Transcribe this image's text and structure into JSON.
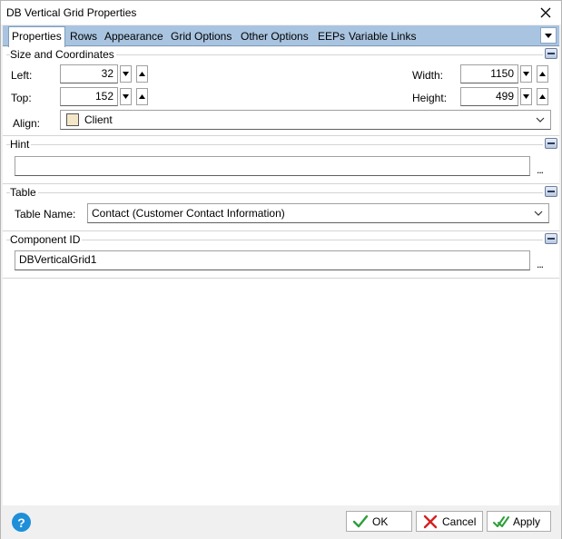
{
  "window": {
    "title": "DB Vertical Grid Properties"
  },
  "tabs": [
    {
      "label": "Properties",
      "active": true
    },
    {
      "label": "Rows"
    },
    {
      "label": "Appearance"
    },
    {
      "label": "Grid Options"
    },
    {
      "label": "Other Options"
    },
    {
      "label": "EEPs"
    },
    {
      "label": "Variable Links"
    }
  ],
  "size_section": {
    "title": "Size and Coordinates",
    "left_label": "Left:",
    "left_value": "32",
    "top_label": "Top:",
    "top_value": "152",
    "width_label": "Width:",
    "width_value": "1150",
    "height_label": "Height:",
    "height_value": "499",
    "align_label": "Align:",
    "align_value": "Client",
    "align_swatch_color": "#f3e7c8"
  },
  "hint_section": {
    "title": "Hint",
    "value": "",
    "more": "..."
  },
  "table_section": {
    "title": "Table",
    "table_label": "Table Name:",
    "table_value": "Contact  (Customer Contact Information)"
  },
  "component_section": {
    "title": "Component ID",
    "value": "DBVerticalGrid1",
    "more": "..."
  },
  "footer": {
    "help": "?",
    "ok_label": "OK",
    "cancel_label": "Cancel",
    "apply_label": "Apply"
  },
  "colors": {
    "tabbar": "#a9c4e0",
    "help": "#1e8fd8",
    "ok_check": "#2e9e3a",
    "cancel_x": "#d42020"
  }
}
